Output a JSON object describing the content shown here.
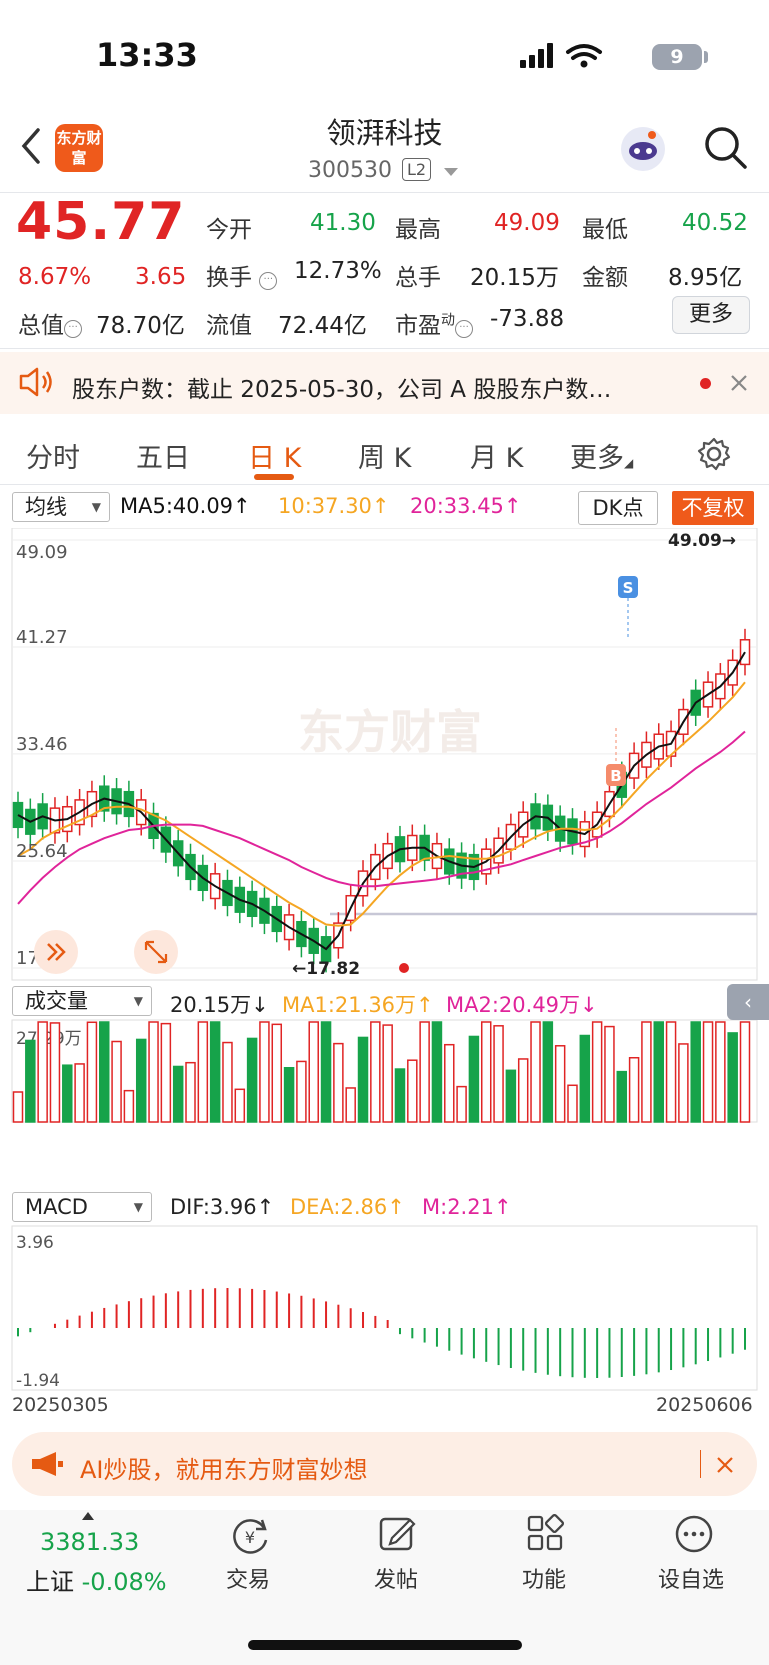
{
  "status_bar": {
    "time": "13:33",
    "battery": "9"
  },
  "header": {
    "title": "领湃科技",
    "code": "300530",
    "level_badge": "L2",
    "logo_text": "东方财富"
  },
  "quote": {
    "price": "45.77",
    "change_pct": "8.67%",
    "change": "3.65",
    "open_label": "今开",
    "open": "41.30",
    "high_label": "最高",
    "high": "49.09",
    "low_label": "最低",
    "low": "40.52",
    "turnover_label": "换手",
    "turnover": "12.73%",
    "volume_label": "总手",
    "volume": "20.15万",
    "amount_label": "金额",
    "amount": "8.95亿",
    "mktcap_label": "总值",
    "mktcap": "78.70亿",
    "float_label": "流值",
    "float": "72.44亿",
    "pe_label": "市盈",
    "pe_sup": "动",
    "pe": "-73.88",
    "more_button": "更多"
  },
  "notice": {
    "text": "股东户数：截止 2025-05-30，公司 A 股股东户数…"
  },
  "tabs": [
    {
      "label": "分时"
    },
    {
      "label": "五日"
    },
    {
      "label": "日 K"
    },
    {
      "label": "周 K"
    },
    {
      "label": "月 K"
    },
    {
      "label": "更多"
    }
  ],
  "chart_toolbar": {
    "ma_select": "均线",
    "ma5": "MA5:40.09",
    "ma10": "10:37.30",
    "ma20": "20:33.45",
    "dk_button": "DK点",
    "fq_button": "不复权"
  },
  "colors": {
    "up": "#e02424",
    "down": "#16a34a",
    "ma5": "#111111",
    "ma10": "#f5a623",
    "ma20": "#e0249a",
    "accent": "#e55a12"
  },
  "chart_data": [
    {
      "type": "candlestick",
      "y_ticks": [
        "49.09",
        "41.27",
        "33.46",
        "25.64",
        "17.82"
      ],
      "ylim": [
        17.82,
        49.09
      ],
      "annotations": {
        "high_label": "49.09",
        "low_label": "17.82",
        "signal_s": "S",
        "signal_b": "B"
      },
      "watermark": "东方财富",
      "series": [
        {
          "name": "MA5",
          "values": [
            29.0,
            28.5,
            28.9,
            28.6,
            28.7,
            29.2,
            29.8,
            30.2,
            30.0,
            29.8,
            29.2,
            28.2,
            27.2,
            26.2,
            25.2,
            24.4,
            23.8,
            23.3,
            22.8,
            22.5,
            22.0,
            21.4,
            20.8,
            20.3,
            19.8,
            19.2,
            20.2,
            22.2,
            24.0,
            25.2,
            26.0,
            26.5,
            26.6,
            26.6,
            26.0,
            25.6,
            25.3,
            25.2,
            25.6,
            26.4,
            27.4,
            28.3,
            28.9,
            28.8,
            28.0,
            27.8,
            27.6,
            28.3,
            29.8,
            31.2,
            32.6,
            33.4,
            34.0,
            34.2,
            35.8,
            37.2,
            37.8,
            38.4,
            39.4,
            40.9
          ]
        },
        {
          "name": "MA10",
          "values": [
            26.0,
            26.5,
            27.3,
            27.8,
            28.2,
            28.6,
            29.0,
            29.5,
            29.6,
            29.6,
            29.4,
            29.0,
            28.6,
            28.0,
            27.4,
            26.8,
            26.2,
            25.6,
            25.0,
            24.4,
            23.8,
            23.2,
            22.6,
            22.1,
            21.5,
            21.0,
            20.9,
            21.0,
            21.8,
            22.8,
            23.8,
            24.6,
            25.3,
            25.8,
            25.9,
            26.0,
            25.9,
            25.8,
            25.8,
            26.0,
            26.4,
            26.9,
            27.4,
            27.8,
            28.0,
            28.0,
            27.9,
            28.0,
            28.7,
            29.6,
            30.6,
            31.6,
            32.5,
            33.4,
            34.2,
            35.0,
            35.8,
            36.7,
            37.6,
            38.7
          ]
        },
        {
          "name": "MA20",
          "values": [
            22.5,
            23.5,
            24.4,
            25.2,
            25.9,
            26.5,
            26.9,
            27.3,
            27.6,
            27.9,
            28.0,
            28.2,
            28.3,
            28.3,
            28.3,
            28.2,
            27.9,
            27.6,
            27.3,
            26.9,
            26.5,
            26.1,
            25.7,
            25.2,
            24.8,
            24.4,
            24.1,
            23.9,
            23.8,
            23.8,
            23.9,
            24.0,
            24.1,
            24.2,
            24.3,
            24.5,
            24.7,
            24.8,
            25.0,
            25.2,
            25.4,
            25.7,
            26.0,
            26.3,
            26.6,
            26.8,
            27.0,
            27.3,
            27.8,
            28.4,
            29.1,
            29.8,
            30.4,
            31.0,
            31.7,
            32.4,
            33.0,
            33.6,
            34.3,
            35.1
          ]
        }
      ]
    },
    {
      "type": "bar",
      "title": "成交量",
      "value": "20.15万",
      "ma1": "MA1:21.36万",
      "ma2": "MA2:20.49万",
      "y_max_label": "27.29万"
    },
    {
      "type": "bar",
      "title": "MACD",
      "dif": "DIF:3.96",
      "dea": "DEA:2.86",
      "m": "M:2.21",
      "y_ticks": [
        "3.96",
        "-1.94"
      ],
      "x_start": "20250305",
      "x_end": "20250606"
    }
  ],
  "ad_bar": {
    "text": "AI炒股，就用东方财富妙想"
  },
  "bottom_nav": {
    "index_value": "3381.33",
    "index_label": "上证",
    "index_change": "-0.08%",
    "items": [
      {
        "label": "交易"
      },
      {
        "label": "发帖"
      },
      {
        "label": "功能"
      },
      {
        "label": "设自选"
      }
    ]
  }
}
